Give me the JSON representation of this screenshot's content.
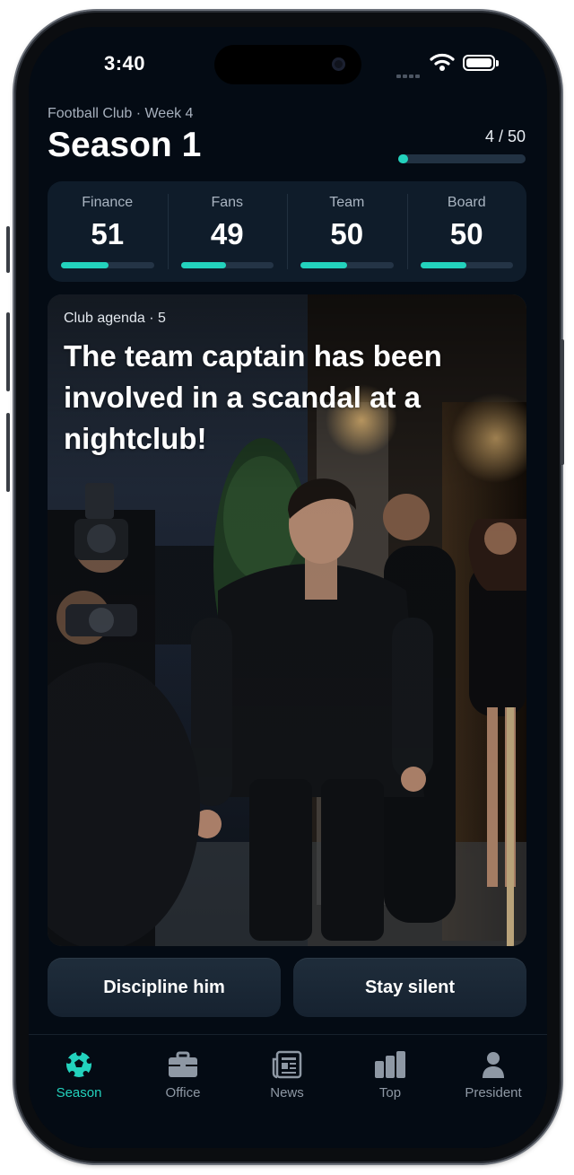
{
  "status_bar": {
    "time": "3:40"
  },
  "header": {
    "subtitle": "Football Club · Week 4",
    "title": "Season 1",
    "progress_label": "4 / 50",
    "progress_fraction": 0.08
  },
  "stats": [
    {
      "label": "Finance",
      "value": "51",
      "fraction": 0.51
    },
    {
      "label": "Fans",
      "value": "49",
      "fraction": 0.49
    },
    {
      "label": "Team",
      "value": "50",
      "fraction": 0.5
    },
    {
      "label": "Board",
      "value": "50",
      "fraction": 0.5
    }
  ],
  "card": {
    "kicker": "Club agenda · 5",
    "text": "The team captain has been involved in a scandal at a nightclub!"
  },
  "choices": {
    "left": "Discipline him",
    "right": "Stay silent"
  },
  "tabs": [
    {
      "label": "Season",
      "icon": "soccer-ball-icon",
      "active": true
    },
    {
      "label": "Office",
      "icon": "briefcase-icon"
    },
    {
      "label": "News",
      "icon": "newspaper-icon"
    },
    {
      "label": "Top",
      "icon": "bar-chart-icon"
    },
    {
      "label": "President",
      "icon": "person-icon"
    }
  ],
  "colors": {
    "accent": "#23d2bd",
    "background": "#040b14",
    "panel": "#0f1c2a"
  }
}
